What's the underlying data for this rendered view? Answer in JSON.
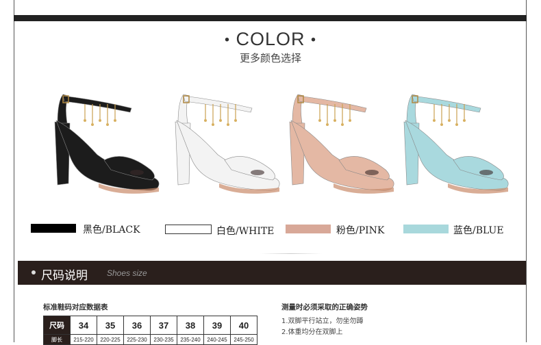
{
  "color_section": {
    "title": "COLOR",
    "subtitle": "更多颜色选择"
  },
  "colors": [
    {
      "label": "黑色/BLACK",
      "swatch": "#000000",
      "shoe": "#1c1c1c"
    },
    {
      "label": "白色/WHITE",
      "swatch": "#ffffff",
      "shoe": "#f3f3f3"
    },
    {
      "label": "粉色/PINK",
      "swatch": "#d8a898",
      "shoe": "#e4b8a4"
    },
    {
      "label": "蓝色/BLUE",
      "swatch": "#a8d8dc",
      "shoe": "#a9d9de"
    }
  ],
  "size_section": {
    "title_cn": "尺码说明",
    "title_en": "Shoes size"
  },
  "size_table": {
    "title": "标准鞋码对应数据表",
    "header_label": "尺码",
    "sizes": [
      "34",
      "35",
      "36",
      "37",
      "38",
      "39",
      "40"
    ],
    "row2_label": "脚长",
    "row2_values": [
      "215-220",
      "220-225",
      "225-230",
      "230-235",
      "235-240",
      "240-245",
      "245-250"
    ]
  },
  "measure": {
    "title": "测量时必须采取的正确姿势",
    "steps": [
      "1.双脚平行站立，勿坐勿蹲",
      "2.体重均分在双脚上"
    ]
  }
}
